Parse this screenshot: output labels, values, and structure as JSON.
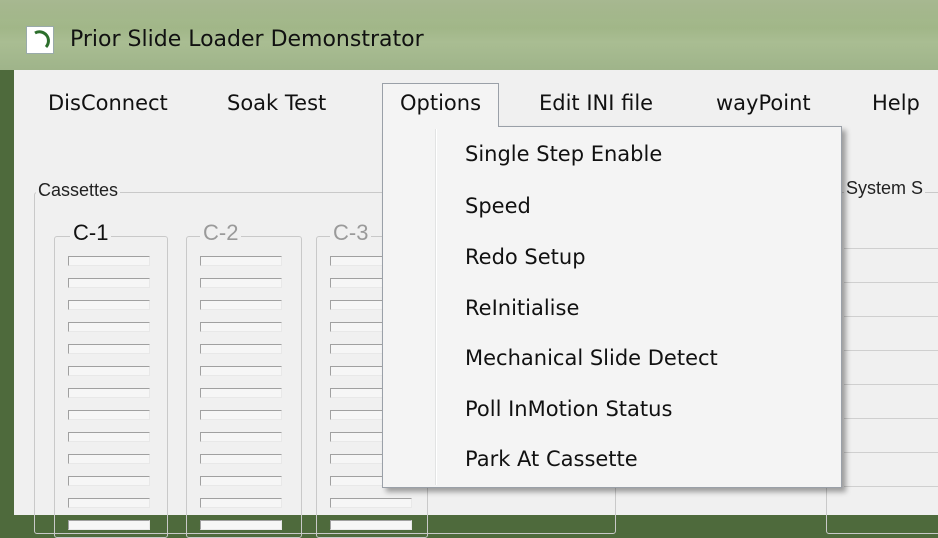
{
  "window": {
    "title": "Prior Slide Loader Demonstrator",
    "icon": "app-arc-icon"
  },
  "menu": {
    "items": [
      "DisConnect",
      "Soak Test",
      "Options",
      "Edit INI file",
      "wayPoint",
      "Help"
    ],
    "open": "Options"
  },
  "options_menu": {
    "items": [
      "Single Step Enable",
      "Speed",
      "Redo Setup",
      "ReInitialise",
      "Mechanical Slide Detect",
      "Poll InMotion Status",
      "Park At Cassette"
    ]
  },
  "cassettes": {
    "label": "Cassettes",
    "columns": [
      "C-1",
      "C-2",
      "C-3"
    ]
  },
  "system_status": {
    "label": "System S"
  },
  "colors": {
    "active_label": "#111111",
    "disabled_label": "#9a9a9a"
  }
}
